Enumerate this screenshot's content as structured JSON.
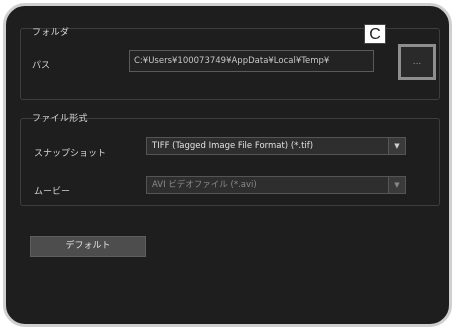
{
  "folder": {
    "title": "フォルダ",
    "path_label": "パス",
    "path_value": "C:¥Users¥100073749¥AppData¥Local¥Temp¥",
    "browse_label": "..."
  },
  "file_format": {
    "title": "ファイル形式",
    "snapshot_label": "スナップショット",
    "snapshot_value": "TIFF (Tagged Image File Format) (*.tif)",
    "movie_label": "ムービー",
    "movie_value": "AVI ビデオファイル (*.avi)"
  },
  "default_button": "デフォルト",
  "callout": "C"
}
